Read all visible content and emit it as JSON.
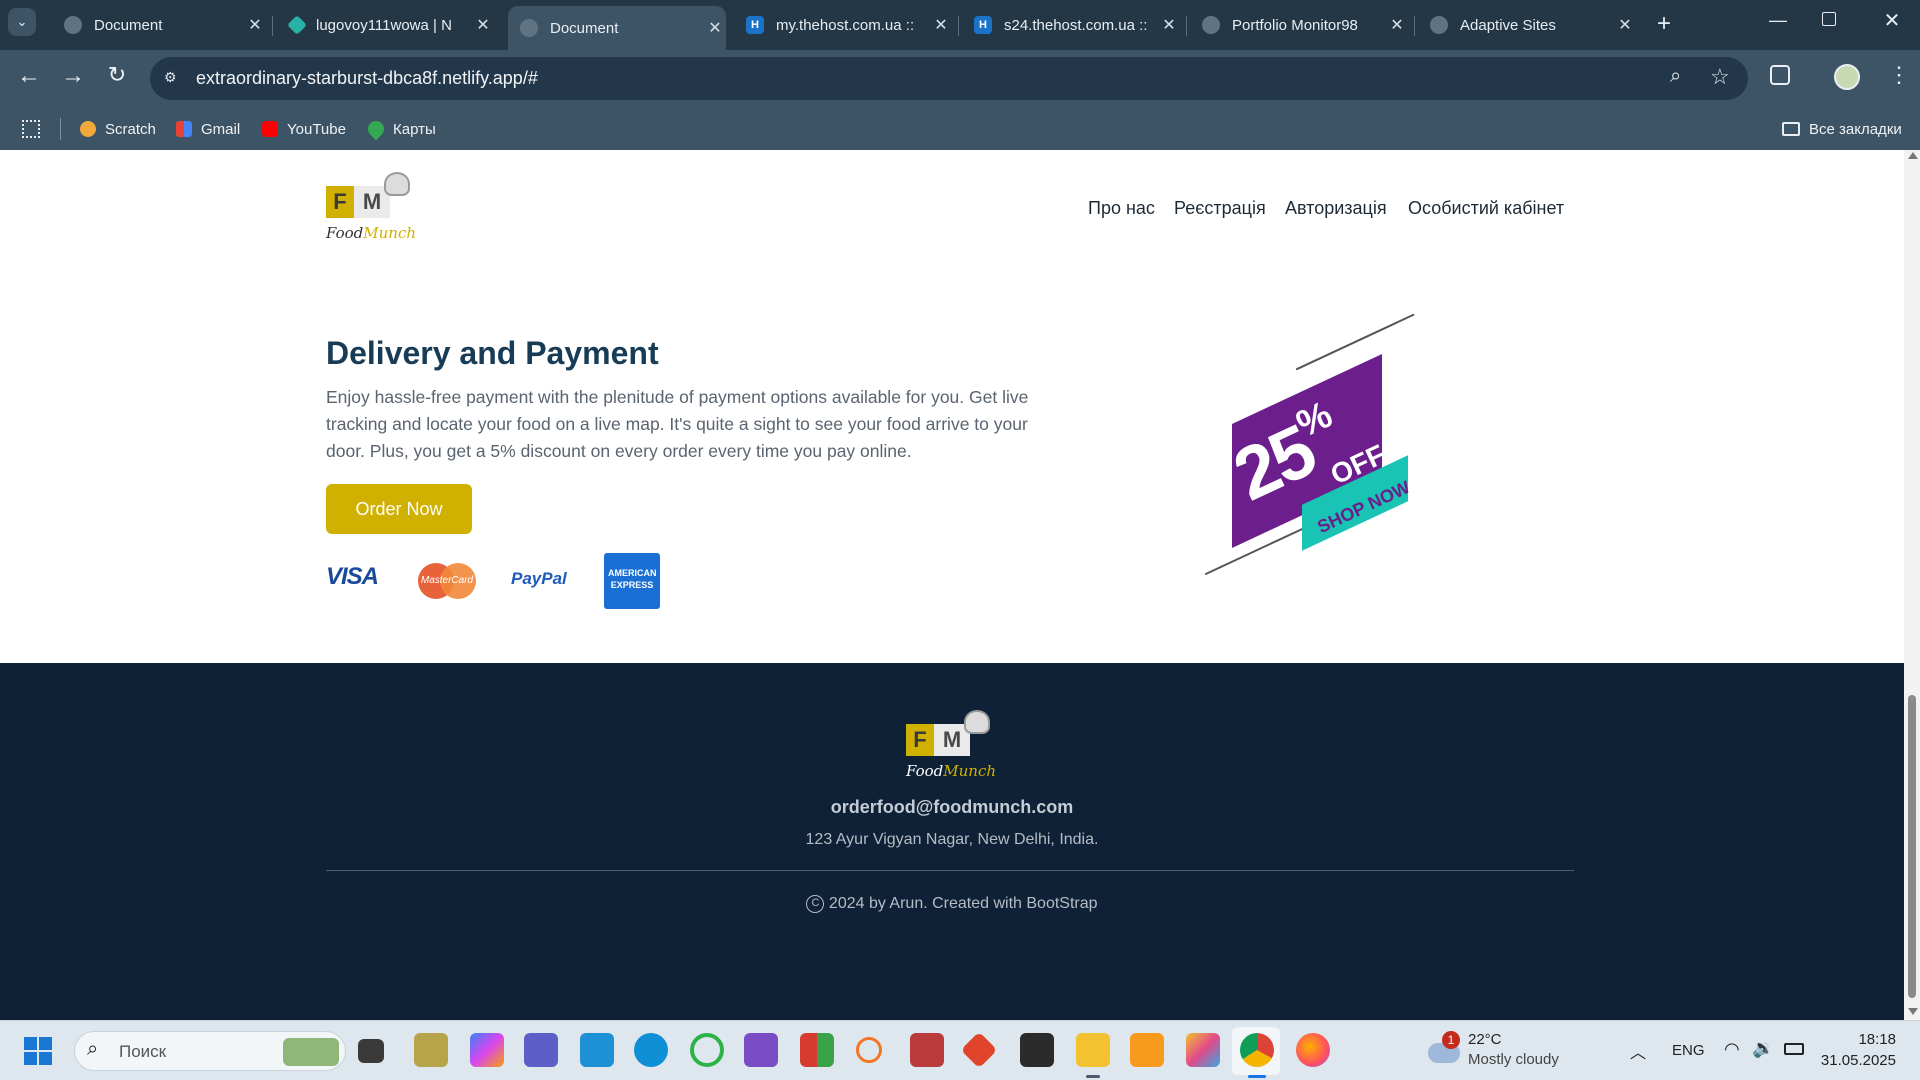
{
  "browser": {
    "tabs": [
      {
        "title": "Document",
        "icon": "globe-icon"
      },
      {
        "title": "lugovoy111wowa | N",
        "icon": "netlify-icon"
      },
      {
        "title": "Document",
        "icon": "globe-icon",
        "active": true
      },
      {
        "title": "my.thehost.com.ua ::",
        "icon": "thehost-icon"
      },
      {
        "title": "s24.thehost.com.ua ::",
        "icon": "thehost-icon"
      },
      {
        "title": "Portfolio Monitor98",
        "icon": "globe-icon"
      },
      {
        "title": "Adaptive Sites",
        "icon": "globe-icon"
      }
    ],
    "url": "extraordinary-starburst-dbca8f.netlify.app/#",
    "bookmarks": [
      "Scratch",
      "Gmail",
      "YouTube",
      "Карты"
    ],
    "all_bookmarks_label": "Все закладки"
  },
  "site": {
    "logo_letters": "FM",
    "logo_f": "F",
    "logo_m": "M",
    "logo_text_food": "Food",
    "logo_text_munch": "Munch",
    "nav": [
      "Про нас",
      "Реєстрація",
      "Авторизація",
      "Особистий кабінет"
    ],
    "section": {
      "title": "Delivery and Payment",
      "text": "Enjoy hassle-free payment with the plenitude of payment options available for you. Get live tracking and locate your food on a live map. It's quite a sight to see your food arrive to your door. Plus, you get a 5% discount on every order every time you pay online.",
      "button": "Order Now",
      "payments": [
        "VISA",
        "MasterCard",
        "PayPal",
        "AMERICAN EXPRESS"
      ]
    },
    "promo": {
      "percent": "25",
      "pct_sign": "%",
      "off": "OFF",
      "shop": "SHOP NOW"
    },
    "footer": {
      "email": "orderfood@foodmunch.com",
      "address": "123 Ayur Vigyan Nagar, New Delhi, India.",
      "copyright": "2024 by Arun. Created with BootStrap"
    }
  },
  "taskbar": {
    "search_placeholder": "Поиск",
    "weather_temp": "22°C",
    "weather_desc": "Mostly cloudy",
    "weather_badge": "1",
    "lang": "ENG",
    "time": "18:18",
    "date": "31.05.2025"
  },
  "colors": {
    "accent_yellow": "#d0b000",
    "footer_bg": "#0e2136",
    "heading": "#183b56",
    "promo_purple": "#6c1e8c",
    "promo_teal": "#19c4b4"
  }
}
